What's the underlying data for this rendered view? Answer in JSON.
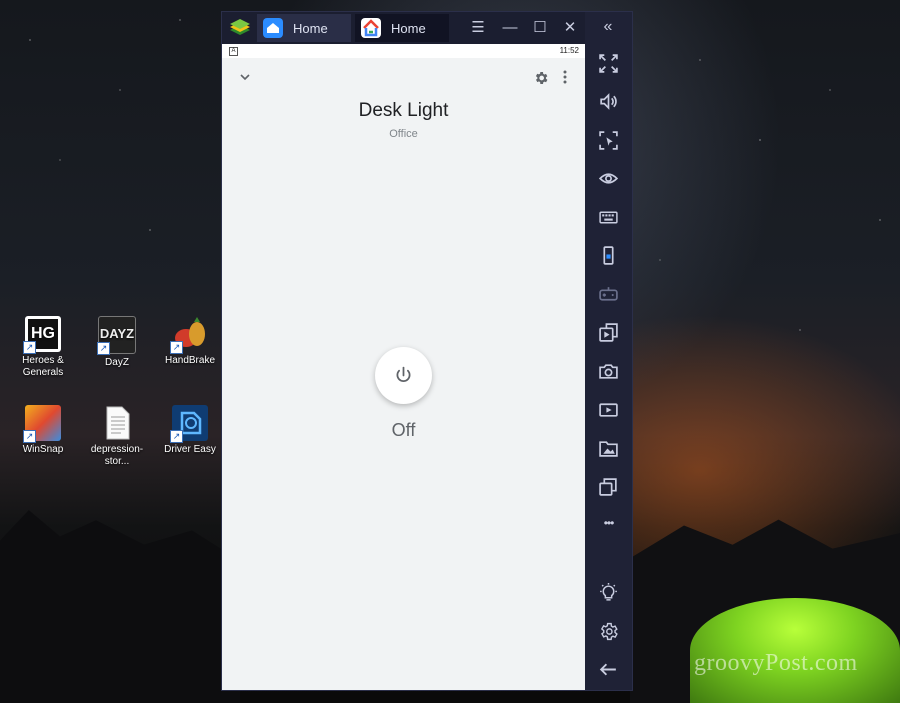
{
  "desktop": {
    "icons": [
      {
        "label": "Heroes &\nGenerals",
        "name": "heroes-generals"
      },
      {
        "label": "DayZ",
        "name": "dayz"
      },
      {
        "label": "HandBrake",
        "name": "handbrake"
      },
      {
        "label": "WinSnap",
        "name": "winsnap"
      },
      {
        "label": "depression-stor...",
        "name": "depression-stor"
      },
      {
        "label": "Driver Easy",
        "name": "driver-easy"
      }
    ],
    "watermark": "groovyPost.com",
    "icon_texts": {
      "hg": "HG",
      "dayz": "DAYZ"
    }
  },
  "window": {
    "tabs": [
      {
        "label": "Home"
      },
      {
        "label": "Home"
      }
    ],
    "controls": {
      "menu": "☰",
      "minimize": "—",
      "maximize": "☐",
      "close": "✕"
    },
    "collapse_glyph": "«"
  },
  "screen": {
    "status_time": "11:52",
    "status_note": "A",
    "device_name": "Desk Light",
    "room_name": "Office",
    "state": "Off"
  },
  "sidebar": {
    "items": [
      "fullscreen-icon",
      "volume-icon",
      "cursor-icon",
      "eye-icon",
      "keyboard-icon",
      "phone-rotate-icon",
      "gamepad-icon",
      "apk-icon",
      "camera-icon",
      "record-icon",
      "gallery-icon",
      "multi-instance-icon",
      "more-icon",
      "bulb-icon",
      "settings-icon",
      "back-icon"
    ],
    "more_glyph": "•••"
  },
  "colors": {
    "window_bg": "#1f2236",
    "screen_bg": "#f1f3f4",
    "accent_green": "#7ed321"
  }
}
